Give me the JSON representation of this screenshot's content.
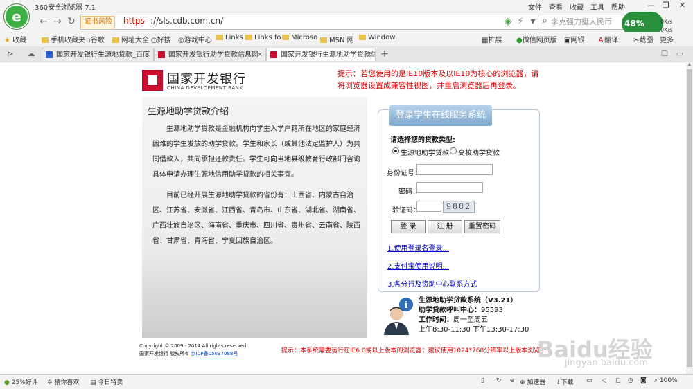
{
  "browser": {
    "title": "360安全浏览器 7.1",
    "menu": [
      "文件",
      "查看",
      "收藏",
      "工具",
      "帮助"
    ],
    "cert_warning": "证书风险",
    "url_scheme": "https",
    "url_rest": "://sls.cdb.com.cn/",
    "search_text": "李克强力挺人民币",
    "speed_percent": "48%",
    "speed_up": "0K/s",
    "speed_down": "0K/s",
    "bookmarks": [
      "收藏",
      "手机收藏夹",
      "谷歌",
      "网址大全",
      "好搜",
      "游戏中心",
      "Links",
      "Links fo",
      "Microso",
      "MSN 网",
      "Window"
    ],
    "bookmarks_right": [
      "扩展",
      "微信网页版",
      "网银",
      "翻译",
      "截图",
      "更多"
    ],
    "tabs": [
      {
        "label": "国家开发银行生源地贷款_百度"
      },
      {
        "label": "国家开发银行助学贷款信息网"
      },
      {
        "label": "国家开发银行生源地助学贷款信"
      }
    ],
    "new_tab": "+"
  },
  "page": {
    "logo_cn": "国家开发银行",
    "logo_en": "CHINA DEVELOPMENT BANK",
    "tip_top": "提示：若您使用的是IE10版本及以IE10为核心的浏览器，请将浏览器设置成兼容性视图，并重启浏览器后再登录。",
    "intro_title": "生源地助学贷款介绍",
    "intro_p1": "生源地助学贷款是金融机构向学生入学户籍所在地区的家庭经济困难的学生发放的助学贷款。学生和家长（或其他法定监护人）为共同借款人，共同承担还款责任。学生可向当地县级教育行政部门咨询具体申请办理生源地信用助学贷款的相关事宜。",
    "intro_p2": "目前已经开展生源地助学贷款的省份有：山西省、内蒙古自治区、江苏省、安徽省、江西省、青岛市、山东省、湖北省、湖南省、广西壮族自治区、海南省、重庆市、四川省、贵州省、云南省、陕西省、甘肃省、青海省、宁夏回族自治区。",
    "copyright_line1": "Copyright © 2009 - 2014 All rights reserved.",
    "copyright_line2": "国家开发银行 版权所有",
    "icp": "京ICP备05037088号",
    "login": {
      "header": "登录学生在线服务系统",
      "loan_type_label": "请选择您的贷款类型:",
      "option1": "生源地助学贷款",
      "option2": "高校助学贷款",
      "id_label": "身份证号：",
      "password_label": "密码：",
      "captcha_label": "验证码：",
      "captcha_value": "9882",
      "btn_login": "登 录",
      "btn_register": "注 册",
      "btn_reset": "重置密码",
      "link1": "1.使用登录名登录...",
      "link2": "2.支付宝使用说明...",
      "link3": "3.各分行及资助中心联系方式"
    },
    "support": {
      "system": "生源地助学贷款系统（V3.21）",
      "hotline_label": "助学贷款呼叫中心：",
      "hotline": "95593",
      "hours_label": "工作时间：",
      "hours_days": "周一至周五",
      "hours_time": "上午8:30-11:30  下午13:30-17:30"
    },
    "tip_bottom": "提示：本系统需要运行在IE6.0或以上版本的浏览器；建议使用1024*768分辨率以上版本浏览..."
  },
  "watermark": {
    "main": "Baidu经验",
    "sub": "jingyan.baidu.com"
  },
  "statusbar": {
    "rating": "25%好评",
    "guess": "猜你喜欢",
    "today": "今日特卖",
    "accelerator": "加速器",
    "download": "下载",
    "zoom": "100%"
  },
  "colors": {
    "accent_red": "#e00000",
    "brand_red": "#c8102e",
    "link_blue": "#0000cc",
    "speed_green": "#2a8f3c"
  }
}
